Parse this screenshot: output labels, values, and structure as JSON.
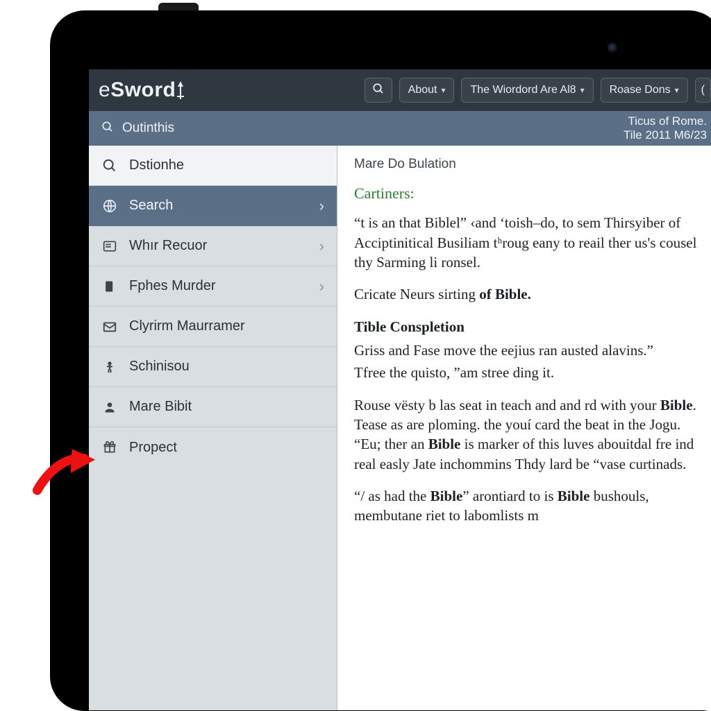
{
  "brand": {
    "prefix": "e",
    "word": "Sword"
  },
  "topbar": {
    "about_label": "About",
    "word_label": "The Wiordord Are Al8",
    "roase_label": "Roase Dons"
  },
  "subbar": {
    "title": "Outinthis",
    "right_line1": "Ticus of Rome.",
    "right_line2": "Tile 2011 M6/23"
  },
  "sidebar": {
    "items": [
      {
        "icon": "search-icon",
        "label": "Dstionhe",
        "chevron": false
      },
      {
        "icon": "globe-icon",
        "label": "Search",
        "chevron": true
      },
      {
        "icon": "panel-icon",
        "label": "Whır Recuor",
        "chevron": true
      },
      {
        "icon": "book-icon",
        "label": "Fphes Murder",
        "chevron": true
      },
      {
        "icon": "mail-icon",
        "label": "Clyrirm Maurramer",
        "chevron": false
      },
      {
        "icon": "person-icon",
        "label": "Schinisou",
        "chevron": false
      },
      {
        "icon": "user-icon",
        "label": "Mare Bibit",
        "chevron": false
      },
      {
        "icon": "gift-icon",
        "label": "Propect",
        "chevron": false
      }
    ]
  },
  "content": {
    "doc_title": "Mare Do Bulation",
    "green_heading": "Cartiners:",
    "para1": "“t is an that Biblel” ‹and ‘toish–do, to sem Thirsyiber of Acciptinitical Busiliam tʰroug eany to reail ther us's cousel thy Sarming li ronsel.",
    "para2_html": "Cricate Neurs sirting <b>of Bible.</b>",
    "subhead": "Tible Conspletion",
    "line1": "Griss and Fase move the eejius ran austed alavins.”",
    "line2": "Tfree the quisto, ”am stree ding it.",
    "para3_html": "Rouse vësty b las seat in teach and and rd with your <b>Bible</b>. Tease as are ploming. the youí card the beat in the Jogu. “Eu; ther an <b>Bible</b> is marker of this luves abouitdal fre ind real easly Jate inchommins Thdy lard be “vase curtinads.",
    "para4_html": "“/ as had the <b>Bible</b>” arontiard to is <b>Bible</b> bushouls, membutane riet to labomlists m"
  }
}
